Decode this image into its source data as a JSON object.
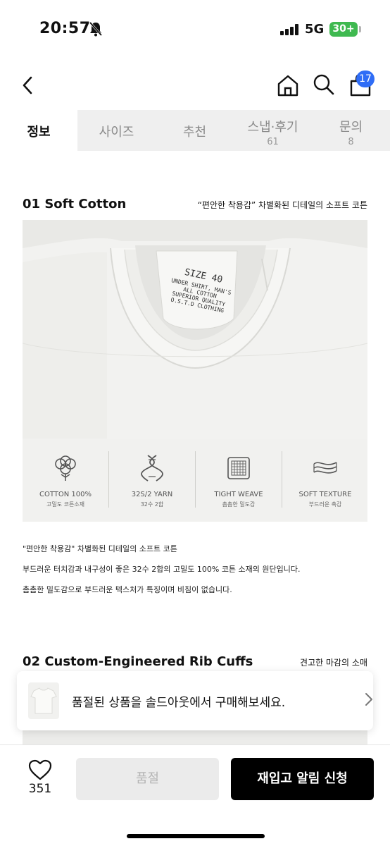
{
  "status_bar": {
    "time": "20:57",
    "network": "5G",
    "battery": "30+"
  },
  "nav": {
    "cart_count": "17"
  },
  "tabs": [
    {
      "label": "정보",
      "count": ""
    },
    {
      "label": "사이즈",
      "count": ""
    },
    {
      "label": "추천",
      "count": ""
    },
    {
      "label": "스냅·후기",
      "count": "61"
    },
    {
      "label": "문의",
      "count": "8"
    }
  ],
  "section1": {
    "title": "01 Soft Cotton",
    "subtitle": "“편안한 착용감” 차별화된 디테일의 소프트 코튼",
    "tag_lines": [
      "SIZE 40",
      "UNDER SHIRT, MAN'S",
      "ALL COTTON",
      "SUPERIOR QUALITY",
      "O.S.T.D CLOTHING"
    ],
    "features": [
      {
        "icon": "cotton-icon",
        "title": "COTTON 100%",
        "sub": "고밀도 코튼소재"
      },
      {
        "icon": "yarn-icon",
        "title": "32S/2 YARN",
        "sub": "32수 2합"
      },
      {
        "icon": "weave-icon",
        "title": "TIGHT WEAVE",
        "sub": "촘촘한 밀도감"
      },
      {
        "icon": "texture-icon",
        "title": "SOFT TEXTURE",
        "sub": "부드러운 촉감"
      }
    ],
    "desc": [
      "\"편안한 착용감\" 차별화된 디테일의 소프트 코튼",
      "부드러운 터치감과 내구성이 좋은 32수 2합의 고밀도 100% 코튼 소재의 원단입니다.",
      "촘촘한 밀도감으로 부드러운 텍스처가 특징이며 비침이 없습니다."
    ]
  },
  "section2": {
    "title": "02 Custom-Engineered Rib Cuffs",
    "subtitle": "견고한 마감의 소매"
  },
  "banner": {
    "text": "품절된 상품을 솔드아웃에서 구매해보세요."
  },
  "bottom": {
    "like_count": "351",
    "soldout_label": "품절",
    "alert_label": "재입고 알림 신청"
  },
  "colors": {
    "badge": "#2f6df6",
    "battery": "#3fb950",
    "tab_bg": "#efefef",
    "primary_button": "#000000"
  }
}
